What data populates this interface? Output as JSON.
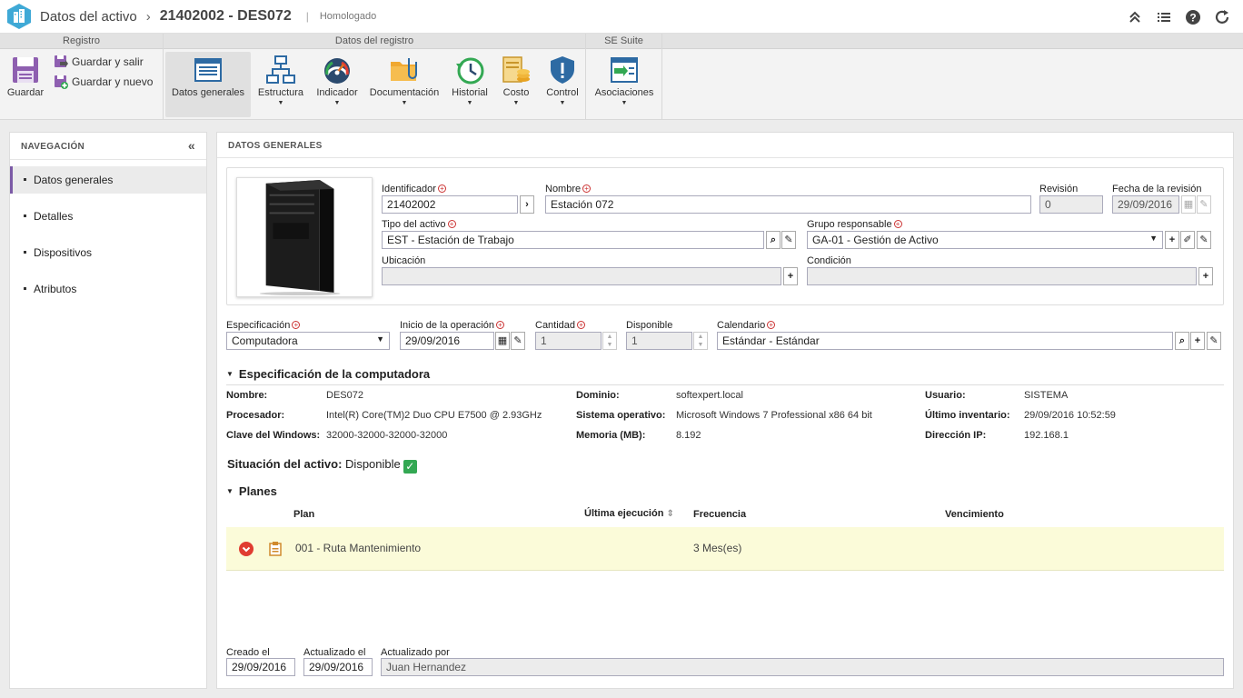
{
  "header": {
    "crumb1": "Datos del activo",
    "crumb_sep": "›",
    "crumb2": "21402002 - DES072",
    "divider": "|",
    "status": "Homologado"
  },
  "ribbon": {
    "groups": {
      "registro": "Registro",
      "datos_registro": "Datos del registro",
      "se_suite": "SE Suite"
    },
    "save": "Guardar",
    "save_exit": "Guardar y salir",
    "save_new": "Guardar y nuevo",
    "buttons": {
      "datos_generales": "Datos generales",
      "estructura": "Estructura",
      "indicador": "Indicador",
      "documentacion": "Documentación",
      "historial": "Historial",
      "costo": "Costo",
      "control": "Control",
      "asociaciones": "Asociaciones"
    }
  },
  "nav": {
    "title": "NAVEGACIÓN",
    "collapse": "«",
    "items": [
      "Datos generales",
      "Detalles",
      "Dispositivos",
      "Atributos"
    ]
  },
  "main": {
    "title": "DATOS GENERALES",
    "fields": {
      "identificador": {
        "label": "Identificador",
        "value": "21402002"
      },
      "nombre": {
        "label": "Nombre",
        "value": "Estación 072"
      },
      "revision": {
        "label": "Revisión",
        "value": "0"
      },
      "fecha_revision": {
        "label": "Fecha de la revisión",
        "value": "29/09/2016"
      },
      "tipo_activo": {
        "label": "Tipo del activo",
        "value": "EST - Estación de Trabajo"
      },
      "grupo_responsable": {
        "label": "Grupo responsable",
        "value": "GA-01 - Gestión de Activo"
      },
      "ubicacion": {
        "label": "Ubicación",
        "value": ""
      },
      "condicion": {
        "label": "Condición",
        "value": ""
      },
      "especificacion": {
        "label": "Especificación",
        "value": "Computadora"
      },
      "inicio_operacion": {
        "label": "Inicio de la operación",
        "value": "29/09/2016"
      },
      "cantidad": {
        "label": "Cantidad",
        "value": "1"
      },
      "disponible": {
        "label": "Disponible",
        "value": "1"
      },
      "calendario": {
        "label": "Calendario",
        "value": "Estándar - Estándar"
      }
    },
    "computer_spec": {
      "title": "Especificación de la computadora",
      "nombre_k": "Nombre:",
      "nombre_v": "DES072",
      "procesador_k": "Procesador:",
      "procesador_v": "Intel(R) Core(TM)2 Duo CPU E7500 @ 2.93GHz",
      "clave_k": "Clave del Windows:",
      "clave_v": "32000-32000-32000-32000",
      "dominio_k": "Dominio:",
      "dominio_v": "softexpert.local",
      "so_k": "Sistema operativo:",
      "so_v": "Microsoft Windows 7 Professional x86 64 bit",
      "memoria_k": "Memoria (MB):",
      "memoria_v": "8.192",
      "usuario_k": "Usuario:",
      "usuario_v": "SISTEMA",
      "inventario_k": "Último inventario:",
      "inventario_v": "29/09/2016 10:52:59",
      "ip_k": "Dirección IP:",
      "ip_v": "192.168.1"
    },
    "situacion": {
      "label": "Situación del activo:",
      "value": "Disponible"
    },
    "planes": {
      "title": "Planes",
      "headers": {
        "plan": "Plan",
        "ultima": "Última ejecución",
        "frecuencia": "Frecuencia",
        "vencimiento": "Vencimiento"
      },
      "rows": [
        {
          "plan": "001 - Ruta Mantenimiento",
          "ultima": "",
          "frecuencia": "3 Mes(es)",
          "vencimiento": ""
        }
      ]
    },
    "footer": {
      "creado_label": "Creado el",
      "creado_value": "29/09/2016",
      "actualizado_label": "Actualizado el",
      "actualizado_value": "29/09/2016",
      "por_label": "Actualizado por",
      "por_value": "Juan Hernandez"
    }
  },
  "colors": {
    "accent": "#7b5aa6",
    "row_highlight": "#fbfbd9",
    "success": "#33a853",
    "error": "#e03c31"
  }
}
